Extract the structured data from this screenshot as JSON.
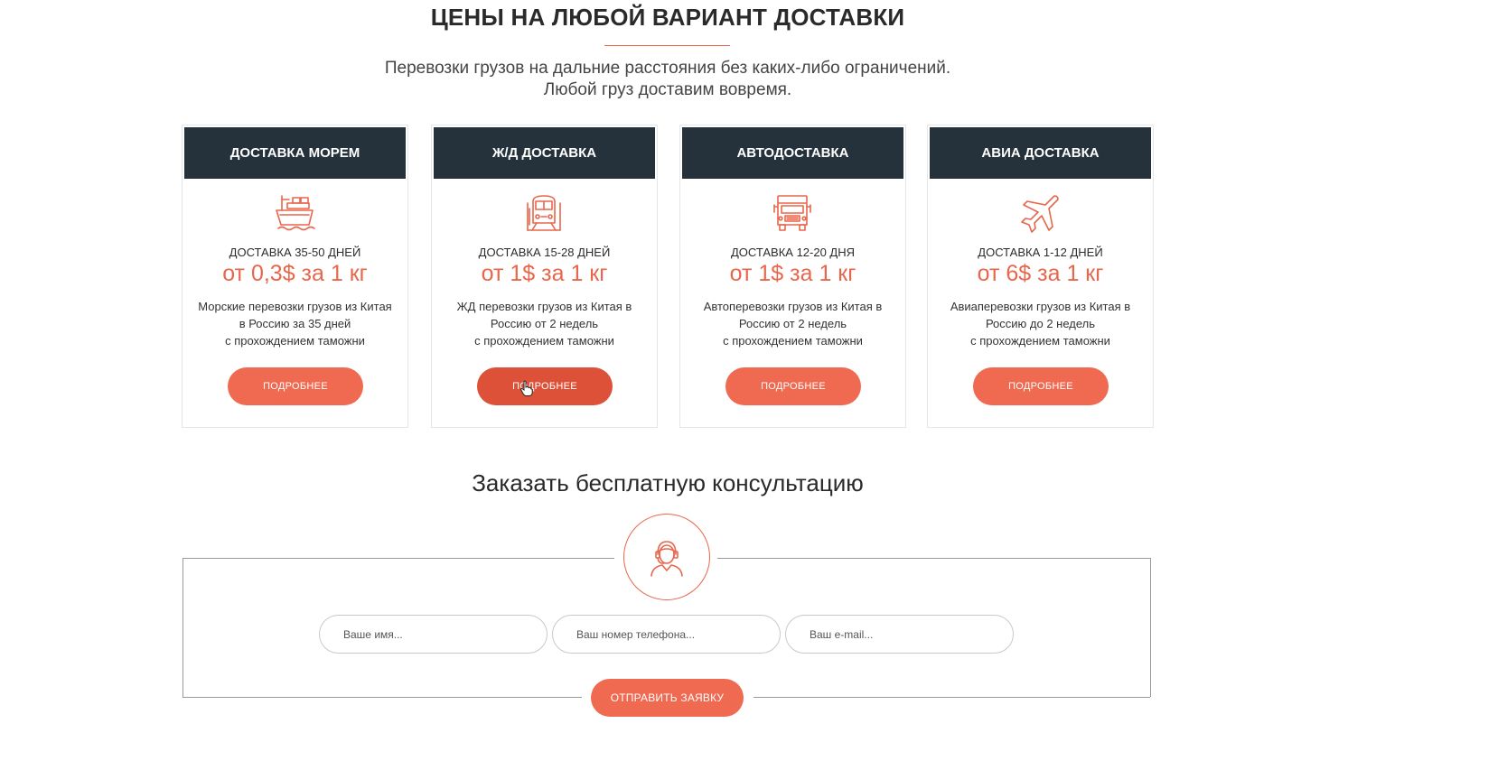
{
  "section": {
    "title": "ЦЕНЫ НА ЛЮБОЙ ВАРИАНТ ДОСТАВКИ",
    "subtitle_line1": "Перевозки грузов на дальние расстояния без каких-либо ограничений.",
    "subtitle_line2": "Любой груз доставим вовремя."
  },
  "cards": [
    {
      "title": "ДОСТАВКА МОРЕМ",
      "icon": "ship-icon",
      "days": "ДОСТАВКА 35-50 ДНЕЙ",
      "price": "от 0,3$ за 1 кг",
      "desc_line1": "Морские перевозки грузов из Китая",
      "desc_line2": "в Россию за 35 дней",
      "desc_line3": "с прохождением таможни",
      "button": "ПОДРОБНЕЕ"
    },
    {
      "title": "Ж/Д ДОСТАВКА",
      "icon": "train-icon",
      "days": "ДОСТАВКА 15-28 ДНЕЙ",
      "price": "от 1$ за 1 кг",
      "desc_line1": "ЖД перевозки грузов из Китая в",
      "desc_line2": "Россию от 2 недель",
      "desc_line3": "с прохождением таможни",
      "button": "ПОДРОБНЕЕ"
    },
    {
      "title": "АВТОДОСТАВКА",
      "icon": "truck-icon",
      "days": "ДОСТАВКА 12-20 ДНЯ",
      "price": "от 1$ за 1 кг",
      "desc_line1": "Автоперевозки грузов из Китая в",
      "desc_line2": "Россию от 2 недель",
      "desc_line3": "с прохождением таможни",
      "button": "ПОДРОБНЕЕ"
    },
    {
      "title": "АВИА ДОСТАВКА",
      "icon": "airplane-icon",
      "days": "ДОСТАВКА 1-12 ДНЕЙ",
      "price": "от 6$ за 1 кг",
      "desc_line1": "Авиаперевозки грузов из Китая в",
      "desc_line2": "Россию до 2 недель",
      "desc_line3": "с прохождением таможни",
      "button": "ПОДРОБНЕЕ"
    }
  ],
  "consult": {
    "title": "Заказать бесплатную консультацию",
    "icon": "support-operator-icon",
    "name_placeholder": "Ваше имя...",
    "phone_placeholder": "Ваш номер телефона...",
    "email_placeholder": "Ваш e-mail...",
    "submit": "ОТПРАВИТЬ ЗАЯВКУ"
  },
  "colors": {
    "accent": "#ef6a50",
    "accent_hover": "#dc5138",
    "card_header": "#25323c"
  }
}
